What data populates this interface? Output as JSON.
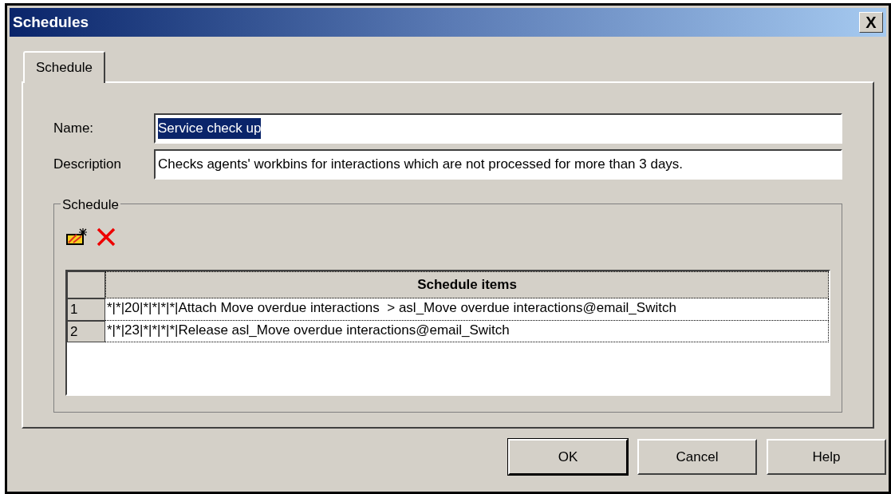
{
  "window": {
    "title": "Schedules",
    "close": "X"
  },
  "tabs": [
    {
      "label": "Schedule",
      "selected": true
    }
  ],
  "fields": [
    {
      "label": "Name:",
      "value": "Service check up",
      "selected": true
    },
    {
      "label": "Description",
      "value": "Checks agents' workbins for interactions which are not processed for more than 3 days.",
      "selected": false
    }
  ],
  "group": {
    "title": "Schedule",
    "table": {
      "columns": [
        "Schedule items"
      ],
      "rows": [
        {
          "number": "1",
          "item": "*|*|20|*|*|*|*|Attach Move overdue interactions  > asl_Move overdue interactions@email_Switch"
        },
        {
          "number": "2",
          "item": "*|*|23|*|*|*|*|Release asl_Move overdue interactions@email_Switch"
        }
      ]
    }
  },
  "buttons": [
    {
      "label": "OK",
      "default": true
    },
    {
      "label": "Cancel",
      "default": false
    },
    {
      "label": "Help",
      "default": false
    }
  ]
}
